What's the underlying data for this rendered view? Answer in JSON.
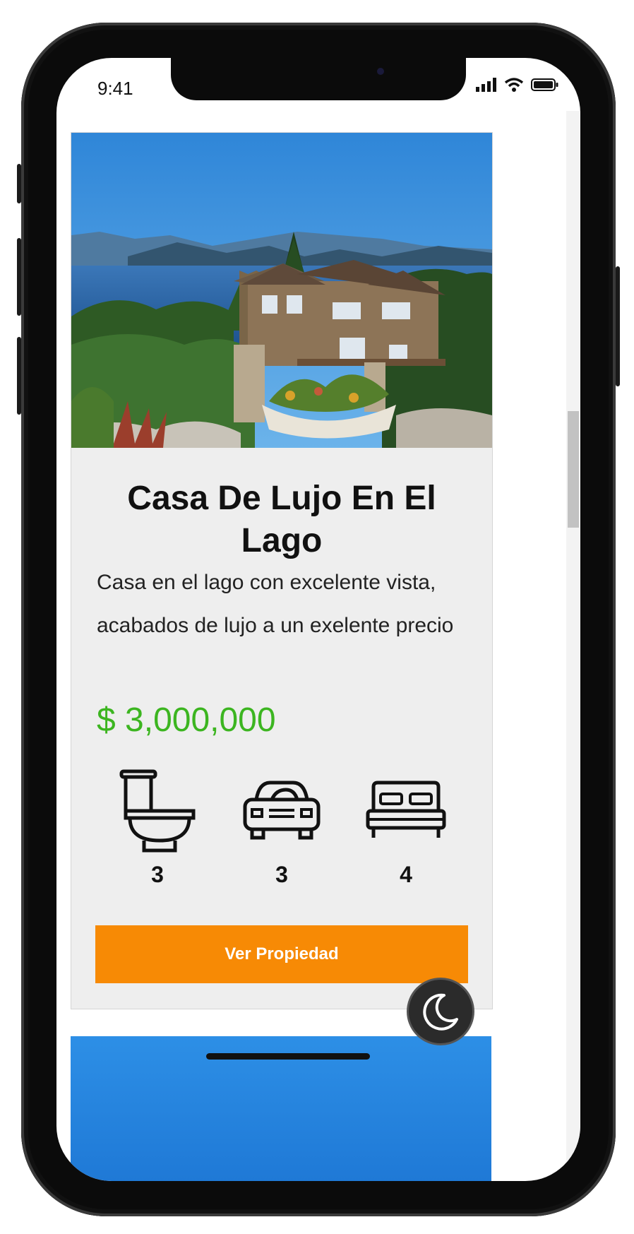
{
  "status_bar": {
    "time": "9:41",
    "signal_icon": "signal-bars-icon",
    "wifi_icon": "wifi-icon",
    "battery_icon": "battery-icon"
  },
  "property": {
    "image_alt": "Casa junto al lago con montañas",
    "title": "Casa De Lujo En El Lago",
    "description": "Casa en el lago con excelente vista, acabados de lujo a un exelente precio",
    "price": "$ 3,000,000",
    "features": [
      {
        "icon": "toilet-icon",
        "count": "3"
      },
      {
        "icon": "car-icon",
        "count": "3"
      },
      {
        "icon": "bed-icon",
        "count": "4"
      }
    ],
    "cta_label": "Ver Propiedad"
  },
  "dark_mode_toggle": {
    "icon": "moon-icon"
  },
  "colors": {
    "price": "#3cb520",
    "cta": "#f78a05",
    "card_bg": "#eeeeee"
  }
}
